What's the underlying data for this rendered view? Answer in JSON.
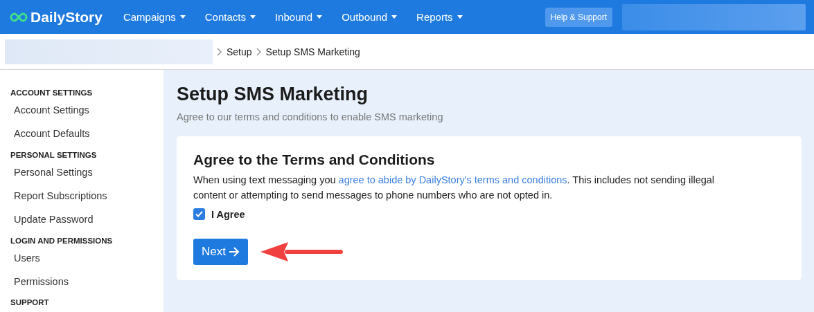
{
  "header": {
    "logo": "DailyStory",
    "menu": [
      {
        "label": "Campaigns"
      },
      {
        "label": "Contacts"
      },
      {
        "label": "Inbound"
      },
      {
        "label": "Outbound"
      },
      {
        "label": "Reports"
      }
    ],
    "help_button": "Help & Support"
  },
  "breadcrumb": [
    "Setup",
    "Setup SMS Marketing"
  ],
  "sidebar": {
    "sections": [
      {
        "heading": "ACCOUNT SETTINGS",
        "items": [
          "Account Settings",
          "Account Defaults"
        ]
      },
      {
        "heading": "PERSONAL SETTINGS",
        "items": [
          "Personal Settings",
          "Report Subscriptions",
          "Update Password"
        ]
      },
      {
        "heading": "LOGIN AND PERMISSIONS",
        "items": [
          "Users",
          "Permissions"
        ]
      },
      {
        "heading": "SUPPORT"
      }
    ]
  },
  "page": {
    "title": "Setup SMS Marketing",
    "subtitle": "Agree to our terms and conditions to enable SMS marketing"
  },
  "card": {
    "title": "Agree to the Terms and Conditions",
    "text_before": "When using text messaging you",
    "link": "agree to abide by DailyStory's terms and conditions",
    "text_after": ". This includes not sending illegal content or attempting to send messages to phone numbers who are not opted in.",
    "checkbox": {
      "label": "I Agree",
      "checked": true
    },
    "next_button": "Next"
  }
}
